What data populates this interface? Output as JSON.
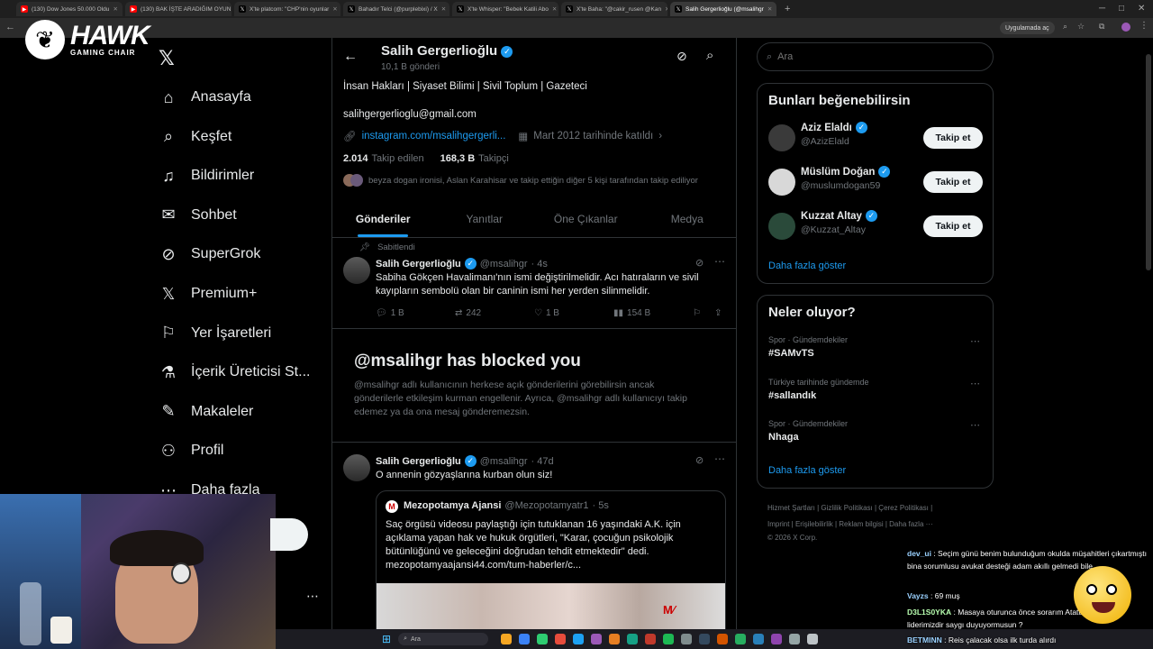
{
  "browser": {
    "tabs": [
      {
        "label": "(130) Dow Jones 50.000 Oldu",
        "color": "#ff0000",
        "icon": "youtube-icon",
        "active": false
      },
      {
        "label": "(130) BAK İŞTE ARADIĞIM OYUN",
        "color": "#ff0000",
        "icon": "youtube-icon",
        "active": false
      },
      {
        "label": "X'te platcom: \"CHP'nin oyunlar",
        "color": "#000000",
        "icon": "x-icon",
        "active": false
      },
      {
        "label": "Bahadır Telci (@purplebixi) / X",
        "color": "#000000",
        "icon": "x-icon",
        "active": false
      },
      {
        "label": "X'te Whisper: \"Bebek Katili Abo",
        "color": "#000000",
        "icon": "x-icon",
        "active": false
      },
      {
        "label": "X'te Baha: \"@cakir_rusen @Kan",
        "color": "#000000",
        "icon": "x-icon",
        "active": false
      },
      {
        "label": "Salih Gergerlioğlu (@msalihgr",
        "color": "#000000",
        "icon": "x-icon",
        "active": true
      }
    ],
    "translate_label": "Uygulamada aç"
  },
  "logo": {
    "brand": "HAWK",
    "sub": "GAMING CHAIR"
  },
  "nav": {
    "items": [
      {
        "label": "Anasayfa",
        "icon": "home-icon",
        "glyph": "⌂"
      },
      {
        "label": "Keşfet",
        "icon": "search-icon",
        "glyph": "⌕"
      },
      {
        "label": "Bildirimler",
        "icon": "bell-icon",
        "glyph": "♫"
      },
      {
        "label": "Sohbet",
        "icon": "mail-icon",
        "glyph": "✉"
      },
      {
        "label": "SuperGrok",
        "icon": "grok-icon",
        "glyph": "⊘"
      },
      {
        "label": "Premium+",
        "icon": "x-logo-icon",
        "glyph": "𝕏"
      },
      {
        "label": "Yer İşaretleri",
        "icon": "bookmark-icon",
        "glyph": "⚐"
      },
      {
        "label": "İçerik Üreticisi St...",
        "icon": "flask-icon",
        "glyph": "⚗"
      },
      {
        "label": "Makaleler",
        "icon": "article-icon",
        "glyph": "✎"
      },
      {
        "label": "Profil",
        "icon": "person-icon",
        "glyph": "⚇"
      },
      {
        "label": "Daha fazla",
        "icon": "more-circle-icon",
        "glyph": "⋯"
      }
    ]
  },
  "profile": {
    "name": "Salih Gergerlioğlu",
    "posts_count": "10,1 B gönderi",
    "bio": "İnsan Hakları | Siyaset Bilimi | Sivil Toplum | Gazeteci",
    "email": "salihgergerlioglu@gmail.com",
    "link": "instagram.com/msalihgergerli...",
    "joined": "Mart 2012 tarihinde katıldı",
    "following_count": "2.014",
    "following_label": "Takip edilen",
    "followers_count": "168,3 B",
    "followers_label": "Takipçi",
    "followed_by": "beyza dogan ironisi, Aslan Karahisar ve takip ettiğin diğer 5 kişi tarafından takip ediliyor"
  },
  "profile_tabs": [
    "Gönderiler",
    "Yanıtlar",
    "Öne Çıkanlar",
    "Medya"
  ],
  "pinned_post": {
    "pinned_label": "Sabitlendi",
    "author": "Salih Gergerlioğlu",
    "handle": "@msalihgr",
    "time": "· 4s",
    "text": "Sabiha Gökçen Havalimanı'nın ismi değiştirilmelidir. Acı hatıraların ve sivil kayıpların sembolü olan bir caninin ismi her yerden silinmelidir.",
    "replies": "1 B",
    "reposts": "242",
    "likes": "1 B",
    "views": "154 B"
  },
  "blocked": {
    "title": "@msalihgr has blocked you",
    "body": "@msalihgr adlı kullanıcının herkese açık gönderilerini görebilirsin ancak gönderilerle etkileşim kurman engellenir. Ayrıca, @msalihgr adlı kullanıcıyı takip edemez ya da ona mesaj gönderemezsin."
  },
  "post2": {
    "author": "Salih Gergerlioğlu",
    "handle": "@msalihgr",
    "time": "· 47d",
    "text": "O annenin gözyaşlarına kurban olun siz!",
    "quote_author": "Mezopotamya Ajansi",
    "quote_handle": "@Mezopotamyatr1",
    "quote_time": "· 5s",
    "quote_text": "Saç örgüsü videosu paylaştığı için tutuklanan 16 yaşındaki A.K. için açıklama yapan hak ve hukuk örgütleri, \"Karar, çocuğun psikolojik bütünlüğünü ve geleceğini doğrudan tehdit etmektedir\" dedi. mezopotamyaajansi44.com/tum-haberler/c..."
  },
  "search": {
    "placeholder": "Ara"
  },
  "suggestions": {
    "title": "Bunları beğenebilirsin",
    "follow_label": "Takip et",
    "show_more": "Daha fazla göster",
    "users": [
      {
        "name": "Aziz Elaldı",
        "handle": "@AzizElald"
      },
      {
        "name": "Müslüm Doğan",
        "handle": "@muslumdogan59"
      },
      {
        "name": "Kuzzat Altay",
        "handle": "@Kuzzat_Altay"
      }
    ]
  },
  "trends": {
    "title": "Neler oluyor?",
    "show_more": "Daha fazla göster",
    "items": [
      {
        "context": "Spor · Gündemdekiler",
        "name": "#SAMvTS"
      },
      {
        "context": "Türkiye tarihinde gündemde",
        "name": "#sallandık"
      },
      {
        "context": "Spor · Gündemdekiler",
        "name": "Nhaga"
      }
    ]
  },
  "footer": {
    "line1": "Hizmet Şartları  |  Gizlilik Politikası  |  Çerez Politikası  |",
    "line2": "Imprint  |  Erişilebilirlik  |  Reklam bilgisi  |  Daha fazla ···",
    "line3": "© 2026 X Corp."
  },
  "chat": [
    {
      "user": "dev_ui",
      "color": "#9ad1ff",
      "text": "Seçim günü benim bulunduğum okulda müşahitleri çıkartmıştı bina sorumlusu avukat desteği adam akıllı gelmedi bile"
    },
    {
      "user": "Vayzs",
      "color": "#9ad1ff",
      "text": "69 muş"
    },
    {
      "user": "D3L1S0YKA",
      "color": "#b8ffb0",
      "text": "Masaya oturunca önce sorarım Atatürk kurucu liderimizdir saygı duyuyormusun ?"
    },
    {
      "user": "BETMINN",
      "color": "#9ad1ff",
      "text": "Reis çalacak olsa ilk turda alırdı"
    }
  ],
  "taskbar": {
    "search_label": "Ara"
  }
}
